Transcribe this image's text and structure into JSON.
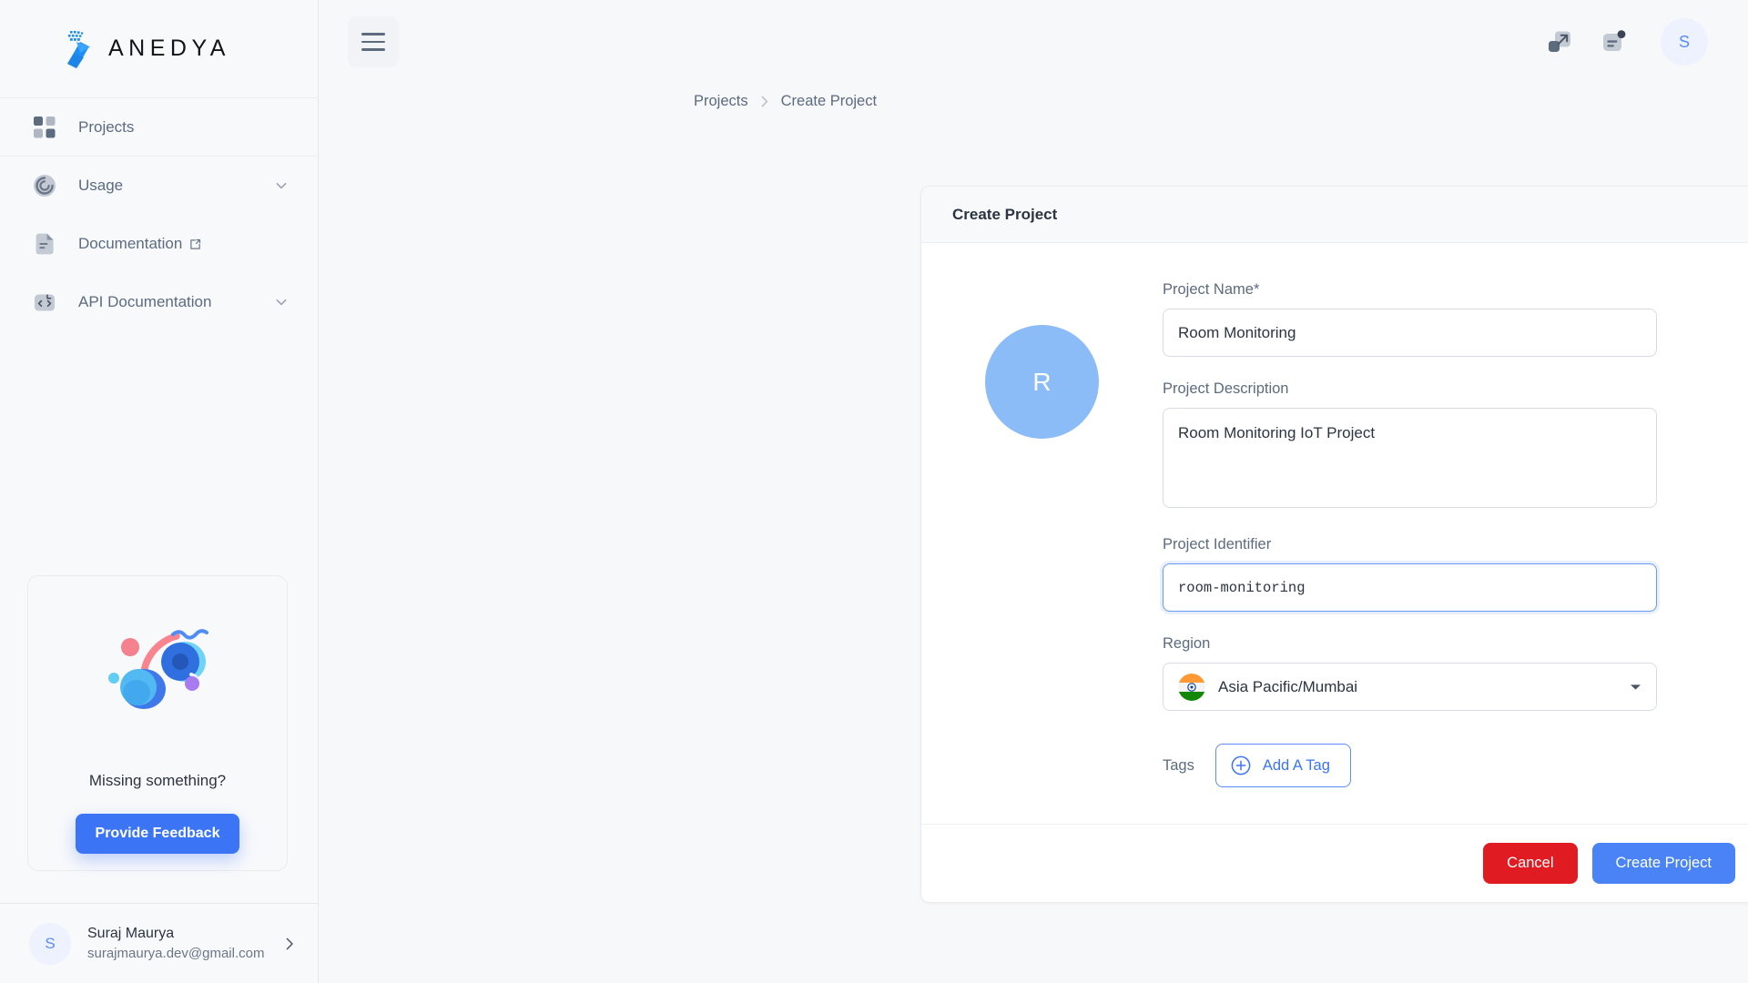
{
  "brand": {
    "name": "ANEDYA",
    "logo_icon": "anedya-logo-icon",
    "accent_blue": "#1f8ff5"
  },
  "sidebar": {
    "items": [
      {
        "label": "Projects",
        "icon": "grid-icon",
        "external": false,
        "expandable": false
      },
      {
        "label": "Usage",
        "icon": "gauge-icon",
        "external": false,
        "expandable": true
      },
      {
        "label": "Documentation",
        "icon": "document-icon",
        "external": true,
        "expandable": false
      },
      {
        "label": "API Documentation",
        "icon": "code-brackets-icon",
        "external": false,
        "expandable": true
      }
    ],
    "feedback": {
      "illustration_icon": "abstract-3d-shapes-illustration",
      "title": "Missing something?",
      "button_label": "Provide Feedback",
      "button_color": "#3b74f5"
    },
    "user": {
      "avatar_initial": "S",
      "name": "Suraj Maurya",
      "email": "surajmaurya.dev@gmail.com",
      "chevron_icon": "chevron-right-icon"
    }
  },
  "topbar": {
    "menu_icon": "hamburger-menu-icon",
    "expand_icon": "expand-arrow-icon",
    "notifications_icon": "notification-bell-icon",
    "avatar_initial": "S"
  },
  "breadcrumb": {
    "items": [
      {
        "label": "Projects",
        "current": false
      },
      {
        "label": "Create Project",
        "current": true
      }
    ],
    "separator_icon": "chevron-right-icon"
  },
  "card": {
    "title": "Create Project",
    "avatar_initial": "R",
    "avatar_color": "#8bbcf7",
    "fields": {
      "project_name": {
        "label": "Project Name",
        "required_marker": "*",
        "value": "Room Monitoring",
        "placeholder": "Project Name"
      },
      "project_description": {
        "label": "Project Description",
        "value": "Room Monitoring IoT Project",
        "placeholder": "Project Description"
      },
      "project_identifier": {
        "label": "Project Identifier",
        "value": "room-monitoring",
        "placeholder": "project-identifier",
        "focused": true
      },
      "region": {
        "label": "Region",
        "value": "Asia Pacific/Mumbai",
        "flag_icon": "india-flag-icon",
        "caret_icon": "chevron-down-icon"
      },
      "tags": {
        "label": "Tags",
        "add_button_label": "Add A Tag",
        "add_button_icon": "plus-circle-icon"
      }
    },
    "footer": {
      "cancel_label": "Cancel",
      "cancel_color": "#e01b22",
      "create_label": "Create Project",
      "create_color": "#4a83f6"
    }
  }
}
